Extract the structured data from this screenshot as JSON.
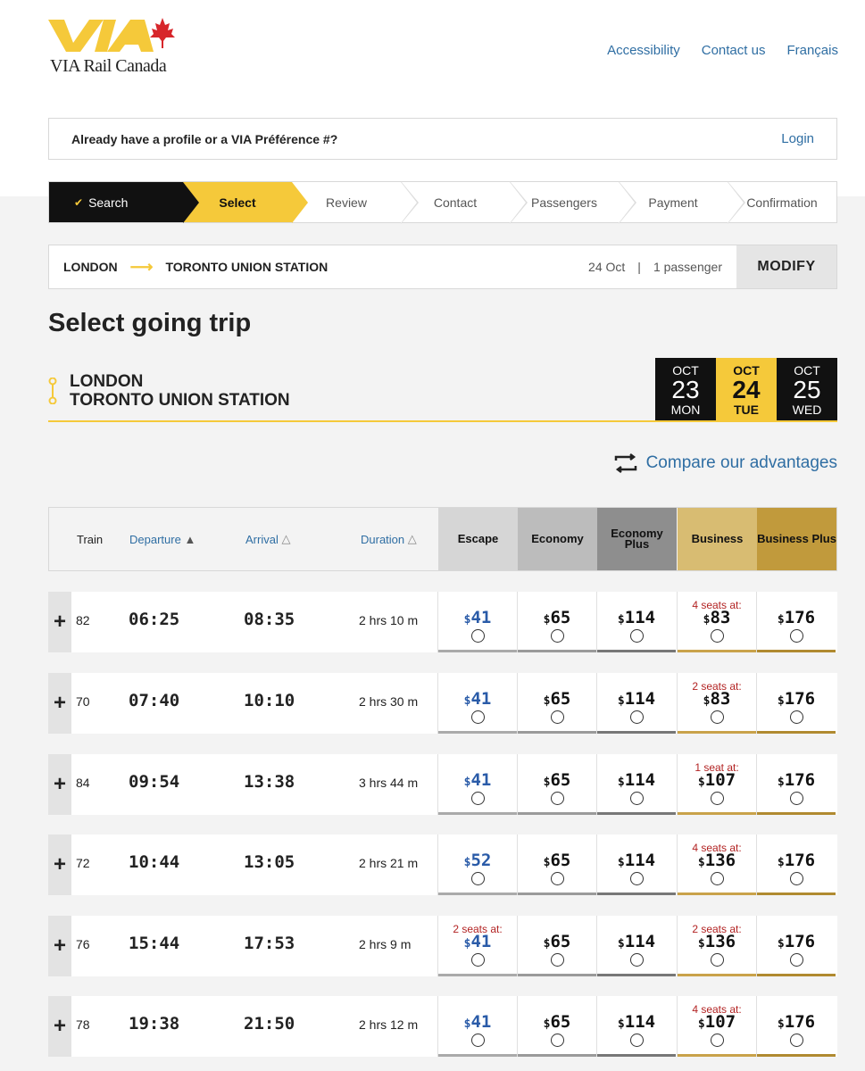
{
  "brand": {
    "name": "VIA Rail Canada"
  },
  "header_links": [
    "Accessibility",
    "Contact us",
    "Français"
  ],
  "profile": {
    "question": "Already have a profile or a VIA Préférence #?",
    "login": "Login"
  },
  "steps": [
    "Search",
    "Select",
    "Review",
    "Contact",
    "Passengers",
    "Payment",
    "Confirmation"
  ],
  "route": {
    "from": "LONDON",
    "to": "TORONTO UNION STATION",
    "date": "24 Oct",
    "separator": "|",
    "passengers": "1 passenger",
    "modify": "MODIFY"
  },
  "page_title": "Select going trip",
  "trip": {
    "origin": "LONDON",
    "destination": "TORONTO UNION STATION"
  },
  "dates": [
    {
      "month": "OCT",
      "day": "23",
      "weekday": "MON"
    },
    {
      "month": "OCT",
      "day": "24",
      "weekday": "TUE"
    },
    {
      "month": "OCT",
      "day": "25",
      "weekday": "WED"
    }
  ],
  "compare_label": "Compare our advantages",
  "columns": {
    "train": "Train",
    "departure": "Departure",
    "arrival": "Arrival",
    "duration": "Duration"
  },
  "fare_classes": [
    {
      "label": "Escape",
      "bg": "#d6d6d6",
      "fg": "#111",
      "bar": "#aaaaaa"
    },
    {
      "label": "Economy",
      "bg": "#bcbcbc",
      "fg": "#111",
      "bar": "#9a9a9a"
    },
    {
      "label": "Economy Plus",
      "bg": "#8e8e8e",
      "fg": "#111",
      "bar": "#777777"
    },
    {
      "label": "Business",
      "bg": "#d8bc72",
      "fg": "#111",
      "bar": "#c9a24a"
    },
    {
      "label": "Business Plus",
      "bg": "#c19a3c",
      "fg": "#111",
      "bar": "#b08a30"
    }
  ],
  "trains": [
    {
      "no": "82",
      "dep": "06:25",
      "arr": "08:35",
      "dur": "2 hrs 10 m",
      "fares": [
        {
          "price": "41",
          "seats": ""
        },
        {
          "price": "65",
          "seats": ""
        },
        {
          "price": "114",
          "seats": ""
        },
        {
          "price": "83",
          "seats": "4 seats at:"
        },
        {
          "price": "176",
          "seats": ""
        }
      ]
    },
    {
      "no": "70",
      "dep": "07:40",
      "arr": "10:10",
      "dur": "2 hrs 30 m",
      "fares": [
        {
          "price": "41",
          "seats": ""
        },
        {
          "price": "65",
          "seats": ""
        },
        {
          "price": "114",
          "seats": ""
        },
        {
          "price": "83",
          "seats": "2 seats at:"
        },
        {
          "price": "176",
          "seats": ""
        }
      ]
    },
    {
      "no": "84",
      "dep": "09:54",
      "arr": "13:38",
      "dur": "3 hrs 44 m",
      "fares": [
        {
          "price": "41",
          "seats": ""
        },
        {
          "price": "65",
          "seats": ""
        },
        {
          "price": "114",
          "seats": ""
        },
        {
          "price": "107",
          "seats": "1 seat at:"
        },
        {
          "price": "176",
          "seats": ""
        }
      ]
    },
    {
      "no": "72",
      "dep": "10:44",
      "arr": "13:05",
      "dur": "2 hrs 21 m",
      "fares": [
        {
          "price": "52",
          "seats": ""
        },
        {
          "price": "65",
          "seats": ""
        },
        {
          "price": "114",
          "seats": ""
        },
        {
          "price": "136",
          "seats": "4 seats at:"
        },
        {
          "price": "176",
          "seats": ""
        }
      ]
    },
    {
      "no": "76",
      "dep": "15:44",
      "arr": "17:53",
      "dur": "2 hrs 9 m",
      "fares": [
        {
          "price": "41",
          "seats": "2 seats at:"
        },
        {
          "price": "65",
          "seats": ""
        },
        {
          "price": "114",
          "seats": ""
        },
        {
          "price": "136",
          "seats": "2 seats at:"
        },
        {
          "price": "176",
          "seats": ""
        }
      ]
    },
    {
      "no": "78",
      "dep": "19:38",
      "arr": "21:50",
      "dur": "2 hrs 12 m",
      "fares": [
        {
          "price": "41",
          "seats": ""
        },
        {
          "price": "65",
          "seats": ""
        },
        {
          "price": "114",
          "seats": ""
        },
        {
          "price": "107",
          "seats": "4 seats at:"
        },
        {
          "price": "176",
          "seats": ""
        }
      ]
    }
  ],
  "currency": "$",
  "colors": {
    "accent": "#f5c93a",
    "link": "#2f6ea3",
    "escape_price": "#2a5ba8",
    "seats_warning": "#b22222"
  }
}
